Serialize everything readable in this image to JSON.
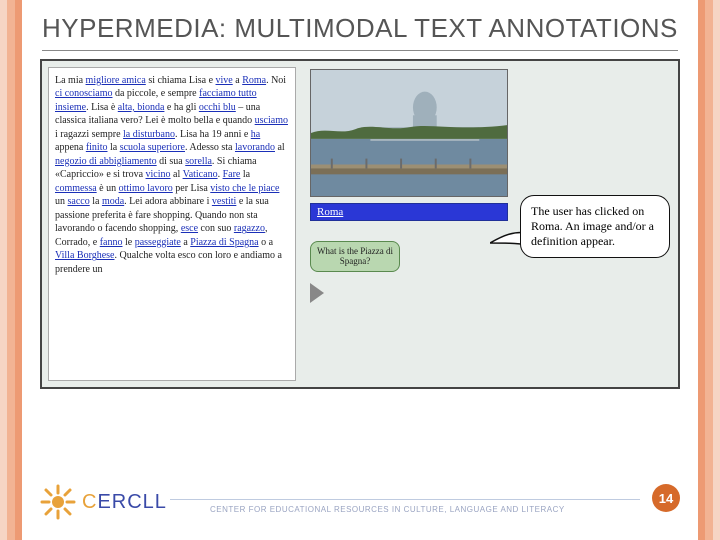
{
  "slide": {
    "title": "HYPERMEDIA: MULTIMODAL TEXT ANNOTATIONS",
    "page_number": "14"
  },
  "passage": {
    "segments": [
      {
        "t": "La mia ",
        "l": false
      },
      {
        "t": "migliore amica",
        "l": true
      },
      {
        "t": " si chiama Lisa e ",
        "l": false
      },
      {
        "t": "vive",
        "l": true
      },
      {
        "t": " a ",
        "l": false
      },
      {
        "t": "Roma",
        "l": true
      },
      {
        "t": ". Noi ",
        "l": false
      },
      {
        "t": "ci conosciamo",
        "l": true
      },
      {
        "t": " da piccole, e sempre ",
        "l": false
      },
      {
        "t": "facciamo tutto insieme",
        "l": true
      },
      {
        "t": ". Lisa è ",
        "l": false
      },
      {
        "t": "alta, bionda",
        "l": true
      },
      {
        "t": " e ha gli ",
        "l": false
      },
      {
        "t": "occhi blu",
        "l": true
      },
      {
        "t": " – una classica italiana vero? Lei è molto bella e quando ",
        "l": false
      },
      {
        "t": "usciamo",
        "l": true
      },
      {
        "t": " i ragazzi sempre ",
        "l": false
      },
      {
        "t": "la disturbano",
        "l": true
      },
      {
        "t": ". Lisa ha 19 anni e ",
        "l": false
      },
      {
        "t": "ha",
        "l": true
      },
      {
        "t": " appena ",
        "l": false
      },
      {
        "t": "finito",
        "l": true
      },
      {
        "t": " la ",
        "l": false
      },
      {
        "t": "scuola superiore",
        "l": true
      },
      {
        "t": ". Adesso sta ",
        "l": false
      },
      {
        "t": "lavorando",
        "l": true
      },
      {
        "t": " al ",
        "l": false
      },
      {
        "t": "negozio di abbigliamento",
        "l": true
      },
      {
        "t": " di sua ",
        "l": false
      },
      {
        "t": "sorella",
        "l": true
      },
      {
        "t": ". Si chiama «Capriccio» e si trova ",
        "l": false
      },
      {
        "t": "vicino",
        "l": true
      },
      {
        "t": " al ",
        "l": false
      },
      {
        "t": "Vaticano",
        "l": true
      },
      {
        "t": ". ",
        "l": false
      },
      {
        "t": "Fare",
        "l": true
      },
      {
        "t": " la ",
        "l": false
      },
      {
        "t": "commessa",
        "l": true
      },
      {
        "t": " è un ",
        "l": false
      },
      {
        "t": "ottimo lavoro",
        "l": true
      },
      {
        "t": " per Lisa ",
        "l": false
      },
      {
        "t": "visto che le piace",
        "l": true
      },
      {
        "t": " un ",
        "l": false
      },
      {
        "t": "sacco",
        "l": true
      },
      {
        "t": " la ",
        "l": false
      },
      {
        "t": "moda",
        "l": true
      },
      {
        "t": ". Lei adora abbinare i ",
        "l": false
      },
      {
        "t": "vestiti",
        "l": true
      },
      {
        "t": " e la sua passione preferita è fare shopping. Quando non sta lavorando o facendo shopping, ",
        "l": false
      },
      {
        "t": "esce",
        "l": true
      },
      {
        "t": " con suo ",
        "l": false
      },
      {
        "t": "ragazzo",
        "l": true
      },
      {
        "t": ", Corrado, e ",
        "l": false
      },
      {
        "t": "fanno",
        "l": true
      },
      {
        "t": " le ",
        "l": false
      },
      {
        "t": "passeggiate",
        "l": true
      },
      {
        "t": " a ",
        "l": false
      },
      {
        "t": "Piazza di Spagna",
        "l": true
      },
      {
        "t": " o a ",
        "l": false
      },
      {
        "t": "Villa Borghese",
        "l": true
      },
      {
        "t": ". Qualche volta esco con loro e andiamo a prendere un",
        "l": false
      }
    ]
  },
  "annotation": {
    "label": "Roma",
    "quiz_button": "What is the Piazza di Spagna?",
    "callout_text": "The user has clicked on Roma. An image and/or a definition appear."
  },
  "footer": {
    "logo_letters": {
      "c": "C",
      "rest": "ERCLL"
    },
    "org_text": "CENTER FOR EDUCATIONAL RESOURCES IN CULTURE, LANGUAGE AND LITERACY"
  }
}
